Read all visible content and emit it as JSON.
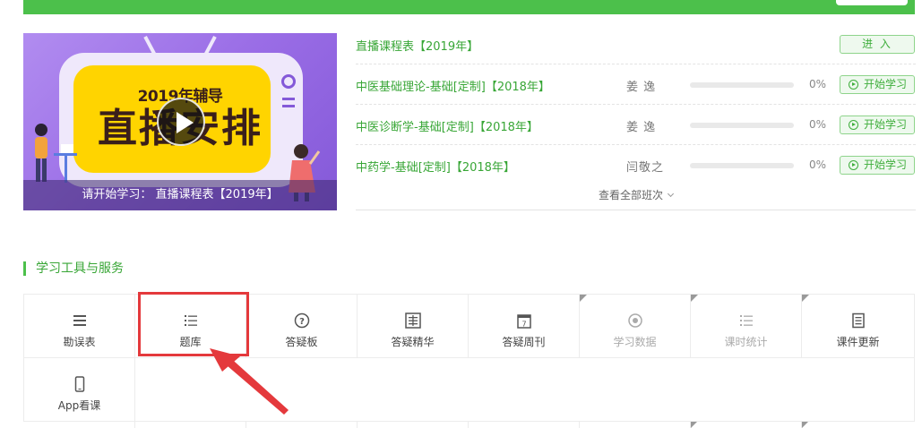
{
  "banner": {
    "line1": "2019年辅导",
    "line2": "直播安排",
    "caption": "请开始学习： 直播课程表【2019年】"
  },
  "courses": [
    {
      "title": "直播课程表【2019年】",
      "teacher": "",
      "progress": "",
      "button": "进 入",
      "button_type": "enter"
    },
    {
      "title": "中医基础理论-基础[定制]【2018年】",
      "teacher": "姜 逸",
      "progress": "0%",
      "progress_value": 0,
      "button": "开始学习",
      "button_type": "start"
    },
    {
      "title": "中医诊断学-基础[定制]【2018年】",
      "teacher": "姜 逸",
      "progress": "0%",
      "progress_value": 0,
      "button": "开始学习",
      "button_type": "start"
    },
    {
      "title": "中药学-基础[定制]【2018年】",
      "teacher": "闫敬之",
      "progress": "0%",
      "progress_value": 0,
      "button": "开始学习",
      "button_type": "start"
    }
  ],
  "view_all": "查看全部班次",
  "tools_section_title": "学习工具与服务",
  "tools": [
    {
      "label": "勘误表",
      "icon": "list-lines-icon"
    },
    {
      "label": "题库",
      "icon": "bullet-list-icon"
    },
    {
      "label": "答疑板",
      "icon": "question-circle-icon"
    },
    {
      "label": "答疑精华",
      "icon": "jing-square-icon"
    },
    {
      "label": "答疑周刊",
      "icon": "calendar-7-icon"
    },
    {
      "label": "学习数据",
      "icon": "target-icon"
    },
    {
      "label": "课时统计",
      "icon": "bullet-list-icon"
    },
    {
      "label": "课件更新",
      "icon": "document-icon"
    },
    {
      "label": "App看课",
      "icon": "phone-icon"
    }
  ],
  "colors": {
    "brand_green": "#4cc04b",
    "link_green": "#38a636",
    "highlight_red": "#e4393c"
  }
}
